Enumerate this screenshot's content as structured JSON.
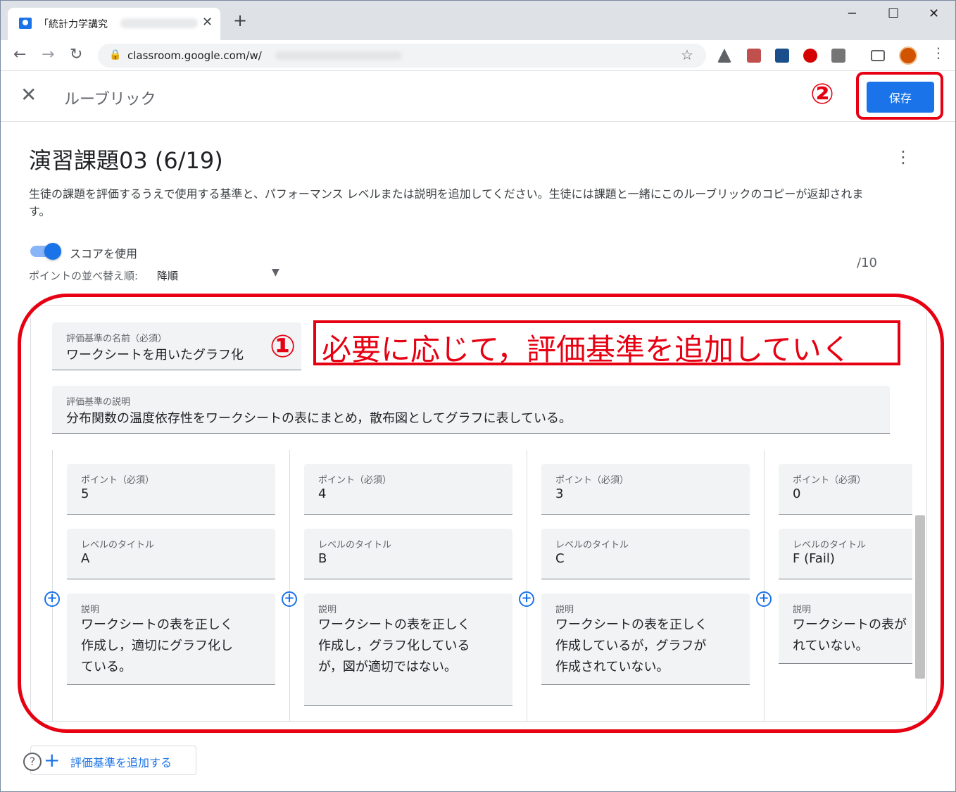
{
  "browser": {
    "tab_title": "「統計力学講究",
    "url": "classroom.google.com/w/"
  },
  "header": {
    "title": "ルーブリック",
    "save_label": "保存"
  },
  "rubric": {
    "title": "演習課題03 (6/19)",
    "description": "生徒の課題を評価するうえで使用する基準と、パフォーマンス レベルまたは説明を追加してください。生徒には課題と一緒にこのルーブリックのコピーが返却されます。",
    "use_score_label": "スコアを使用",
    "sort_label": "ポイントの並べ替え順:",
    "sort_value": "降順",
    "total_points": "/10"
  },
  "criterion": {
    "name_label": "評価基準の名前（必須）",
    "name_value": "ワークシートを用いたグラフ化",
    "desc_label": "評価基準の説明",
    "desc_value": "分布関数の温度依存性をワークシートの表にまとめ，散布図としてグラフに表している。",
    "levels": [
      {
        "points_label": "ポイント（必須）",
        "points": "5",
        "title_label": "レベルのタイトル",
        "title": "A",
        "desc_label": "説明",
        "desc": "ワークシートの表を正しく\n作成し，適切にグラフ化し\nている。"
      },
      {
        "points_label": "ポイント（必須）",
        "points": "4",
        "title_label": "レベルのタイトル",
        "title": "B",
        "desc_label": "説明",
        "desc": "ワークシートの表を正しく\n作成し，グラフ化している\nが，図が適切ではない。"
      },
      {
        "points_label": "ポイント（必須）",
        "points": "3",
        "title_label": "レベルのタイトル",
        "title": "C",
        "desc_label": "説明",
        "desc": "ワークシートの表を正しく\n作成しているが，グラフが\n作成されていない。"
      },
      {
        "points_label": "ポイント（必須）",
        "points": "0",
        "title_label": "レベルのタイトル",
        "title": "F (Fail)",
        "desc_label": "説明",
        "desc": "ワークシートの表が\nれていない。"
      }
    ]
  },
  "footer": {
    "add_criterion_label": "評価基準を追加する"
  },
  "annotations": {
    "step1_marker": "①",
    "step1_text": "必要に応じて，評価基準を追加していく",
    "step2_marker": "②"
  },
  "colors": {
    "accent": "#1a73e8",
    "annotation": "#e60012"
  }
}
